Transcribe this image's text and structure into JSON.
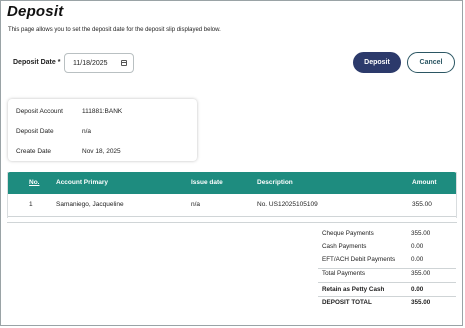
{
  "page": {
    "title": "Deposit",
    "subtitle": "This page allows you to set the deposit date for the deposit slip displayed below."
  },
  "deposit_date": {
    "label": "Deposit Date *",
    "value": "11/18/2025",
    "icon": "calendar-icon"
  },
  "actions": {
    "deposit_label": "Deposit",
    "cancel_label": "Cancel"
  },
  "colors": {
    "primary_button": "#2c3a6b",
    "table_header": "#1e8c7f"
  },
  "info": {
    "rows": [
      {
        "label": "Deposit Account",
        "value": "111881:BANK"
      },
      {
        "label": "Deposit Date",
        "value": "n/a"
      },
      {
        "label": "Create Date",
        "value": "Nov 18, 2025"
      }
    ]
  },
  "table": {
    "columns": [
      "No.",
      "Account Primary",
      "Issue date",
      "Description",
      "Amount"
    ],
    "rows": [
      {
        "no": "1",
        "account_primary": "Samaniego, Jacqueline",
        "issue_date": "n/a",
        "description": "No. US12025105109",
        "amount": "355.00"
      }
    ]
  },
  "summary": {
    "rows": [
      {
        "label": "Cheque Payments",
        "value": "355.00"
      },
      {
        "label": "Cash Payments",
        "value": "0.00"
      },
      {
        "label": "EFT/ACH Debit Payments",
        "value": "0.00"
      },
      {
        "label": "Total Payments",
        "value": "355.00"
      },
      {
        "label": "Retain as Petty Cash",
        "value": "0.00"
      },
      {
        "label": "DEPOSIT TOTAL",
        "value": "355.00"
      }
    ]
  }
}
